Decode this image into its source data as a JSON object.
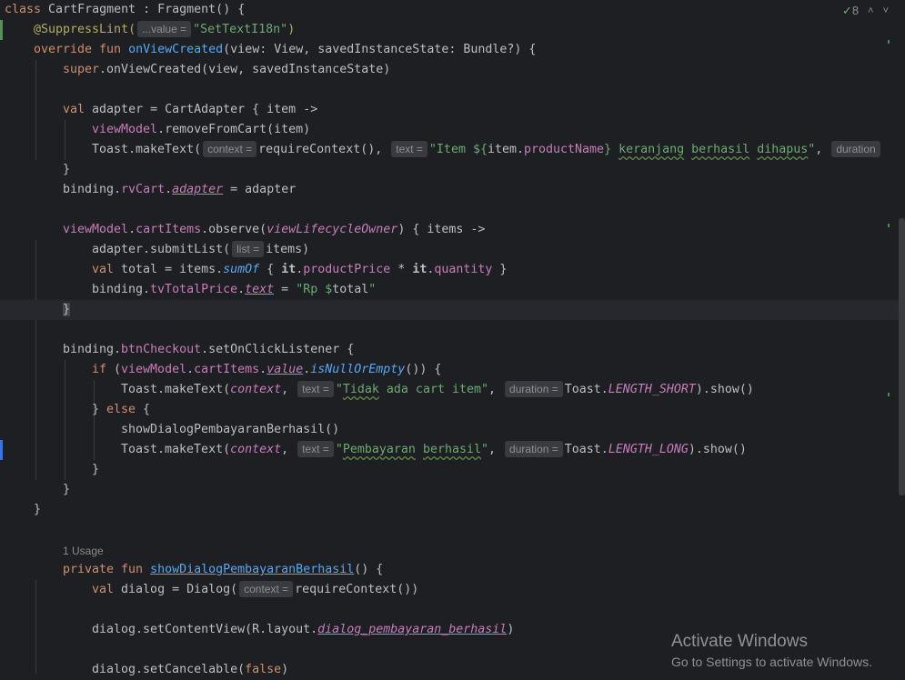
{
  "toolbar": {
    "check_count": "8",
    "up_arrow": "^",
    "down_arrow": "v"
  },
  "code": {
    "l1_kw": "class",
    "l1_name": "CartFragment",
    "l1_rest": " : Fragment() {",
    "l2_ann": "@SuppressLint(",
    "l2_hint": "...value =",
    "l2_str": "\"SetTextI18n\"",
    "l2_end": ")",
    "l3_kw": "override fun",
    "l3_fn": "onViewCreated",
    "l3_rest": "(view: View, savedInstanceState: Bundle?) {",
    "l4_kw": "super",
    "l4_rest": ".onViewCreated(view, savedInstanceState)",
    "l6_kw": "val",
    "l6_rest": " adapter = CartAdapter { item ->",
    "l7_prop": "viewModel",
    "l7_rest": ".removeFromCart(item)",
    "l8_a": "Toast.makeText(",
    "l8_hint1": "context =",
    "l8_b": "requireContext(),",
    "l8_hint2": "text =",
    "l8_s1": "\"Item ${",
    "l8_b2": "item.",
    "l8_p": "productName",
    "l8_s2": "} ",
    "l8_s3": "keranjang",
    "l8_s4": " ",
    "l8_s5": "berhasil",
    "l8_s6": " ",
    "l8_s7": "dihapus",
    "l8_s8": "\"",
    "l8_c": ",",
    "l8_hint3": "duration",
    "l9": "}",
    "l10_a": "binding.",
    "l10_p": "rvCart",
    "l10_b": ".",
    "l10_f": "adapter",
    "l10_c": " = adapter",
    "l12_p": "viewModel",
    "l12_a": ".",
    "l12_p2": "cartItems",
    "l12_b": ".observe(",
    "l12_i": "viewLifecycleOwner",
    "l12_c": ") { items ->",
    "l13_a": "adapter.submitList(",
    "l13_hint": "list =",
    "l13_b": "items)",
    "l14_kw": "val",
    "l14_a": " total = items.",
    "l14_ext": "sumOf",
    "l14_b": " { ",
    "l14_it1": "it",
    "l14_c": ".",
    "l14_p1": "productPrice",
    "l14_d": " * ",
    "l14_it2": "it",
    "l14_e": ".",
    "l14_p2": "quantity",
    "l14_f": " }",
    "l15_a": "binding.",
    "l15_p": "tvTotalPrice",
    "l15_b": ".",
    "l15_f": "text",
    "l15_c": " = ",
    "l15_s": "\"Rp $",
    "l15_v": "total",
    "l15_s2": "\"",
    "l16": "}",
    "l18_a": "binding.",
    "l18_p": "btnCheckout",
    "l18_b": ".setOnClickListener {",
    "l19_kw": "if",
    "l19_a": " (",
    "l19_p": "viewModel",
    "l19_b": ".",
    "l19_p2": "cartItems",
    "l19_c": ".",
    "l19_f": "value",
    "l19_d": ".",
    "l19_ext": "isNullOrEmpty",
    "l19_e": "()) {",
    "l20_a": "Toast.makeText(",
    "l20_ctx": "context",
    "l20_b": ",",
    "l20_hint1": "text =",
    "l20_s1": "\"",
    "l20_s2": "Tidak",
    "l20_s3": " ada cart item\"",
    "l20_c": ",",
    "l20_hint2": "duration =",
    "l20_d": "Toast.",
    "l20_f": "LENGTH_SHORT",
    "l20_e": ").show()",
    "l21_a": "} ",
    "l21_kw": "else",
    "l21_b": " {",
    "l22": "showDialogPembayaranBerhasil()",
    "l23_a": "Toast.makeText(",
    "l23_ctx": "context",
    "l23_b": ",",
    "l23_hint1": "text =",
    "l23_s1": "\"",
    "l23_s2": "Pembayaran",
    "l23_s3": " ",
    "l23_s4": "berhasil",
    "l23_s5": "\"",
    "l23_c": ",",
    "l23_hint2": "duration =",
    "l23_d": "Toast.",
    "l23_f": "LENGTH_LONG",
    "l23_e": ").show()",
    "l24": "}",
    "l25": "}",
    "l26": "}",
    "usage": "1 Usage",
    "l28_kw": "private fun",
    "l28_fn": "showDialogPembayaranBerhasil",
    "l28_rest": "() {",
    "l29_kw": "val",
    "l29_a": " dialog = Dialog(",
    "l29_hint": "context =",
    "l29_b": "requireContext())",
    "l31_a": "dialog.setContentView(R.layout.",
    "l31_f": "dialog_pembayaran_berhasil",
    "l31_b": ")",
    "l33_a": "dialog.setCancelable(",
    "l33_kw": "false",
    "l33_b": ")"
  },
  "watermark": {
    "title": "Activate Windows",
    "subtitle": "Go to Settings to activate Windows."
  }
}
